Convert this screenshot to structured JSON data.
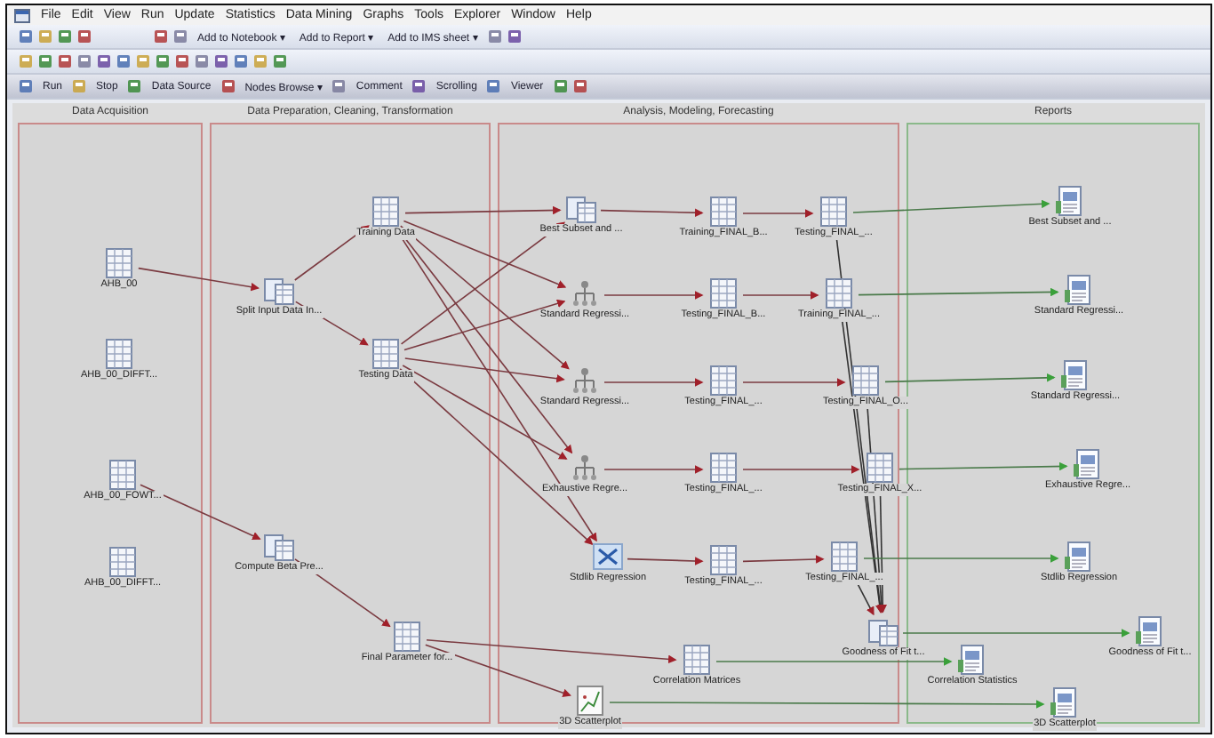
{
  "menu": [
    "File",
    "Edit",
    "View",
    "Run",
    "Update",
    "Statistics",
    "Data Mining",
    "Graphs",
    "Tools",
    "Explorer",
    "Window",
    "Help"
  ],
  "toolbar_1": [
    "Add to Notebook ▾",
    "Add to Report ▾",
    "Add to IMS sheet ▾"
  ],
  "toolbar_3": [
    "Run",
    "Stop",
    "Data Source",
    "Nodes Browse ▾",
    "Comment",
    "Scrolling",
    "Viewer"
  ],
  "lanes": [
    {
      "title": "Data Acquisition",
      "color": "#c98a8a"
    },
    {
      "title": "Data Preparation, Cleaning, Transformation",
      "color": "#c98a8a"
    },
    {
      "title": "Analysis, Modeling, Forecasting",
      "color": "#c98a8a"
    },
    {
      "title": "Reports",
      "color": "#8ab98a"
    }
  ],
  "nodes": [
    {
      "kind": "table",
      "label": "AHB_00"
    },
    {
      "kind": "table",
      "label": "AHB_00_DIFFT..."
    },
    {
      "kind": "table",
      "label": "AHB_00_FOWT..."
    },
    {
      "kind": "table",
      "label": "AHB_00_DIFFT..."
    },
    {
      "kind": "task",
      "label": "Split Input Data In..."
    },
    {
      "kind": "table",
      "label": "Training Data"
    },
    {
      "kind": "table",
      "label": "Testing Data"
    },
    {
      "kind": "task",
      "label": "Compute Beta Pre..."
    },
    {
      "kind": "table",
      "label": "Final Parameter for..."
    },
    {
      "kind": "task",
      "label": "Best Subset and ..."
    },
    {
      "kind": "table",
      "label": "Training_FINAL_B..."
    },
    {
      "kind": "table",
      "label": "Testing_FINAL_..."
    },
    {
      "kind": "model",
      "label": "Standard Regressi..."
    },
    {
      "kind": "table",
      "label": "Testing_FINAL_B..."
    },
    {
      "kind": "table",
      "label": "Training_FINAL_..."
    },
    {
      "kind": "model",
      "label": "Standard Regressi..."
    },
    {
      "kind": "table",
      "label": "Testing_FINAL_..."
    },
    {
      "kind": "table",
      "label": "Testing_FINAL_O..."
    },
    {
      "kind": "model",
      "label": "Exhaustive Regre..."
    },
    {
      "kind": "table",
      "label": "Testing_FINAL_..."
    },
    {
      "kind": "table",
      "label": "Testing_FINAL_X..."
    },
    {
      "kind": "split",
      "label": "Stdlib Regression"
    },
    {
      "kind": "table",
      "label": "Testing_FINAL_..."
    },
    {
      "kind": "table",
      "label": "Testing_FINAL_..."
    },
    {
      "kind": "task",
      "label": "Goodness of Fit t..."
    },
    {
      "kind": "table",
      "label": "Correlation Matrices"
    },
    {
      "kind": "scatter",
      "label": "3D Scatterplot"
    },
    {
      "kind": "report",
      "label": "Correlation Statistics"
    },
    {
      "kind": "report",
      "label": "Best Subset and ..."
    },
    {
      "kind": "report",
      "label": "Standard Regressi..."
    },
    {
      "kind": "report",
      "label": "Standard Regressi..."
    },
    {
      "kind": "report",
      "label": "Exhaustive Regre..."
    },
    {
      "kind": "report",
      "label": "Stdlib Regression"
    },
    {
      "kind": "report",
      "label": "Goodness of Fit t..."
    },
    {
      "kind": "report",
      "label": "3D Scatterplot"
    }
  ]
}
